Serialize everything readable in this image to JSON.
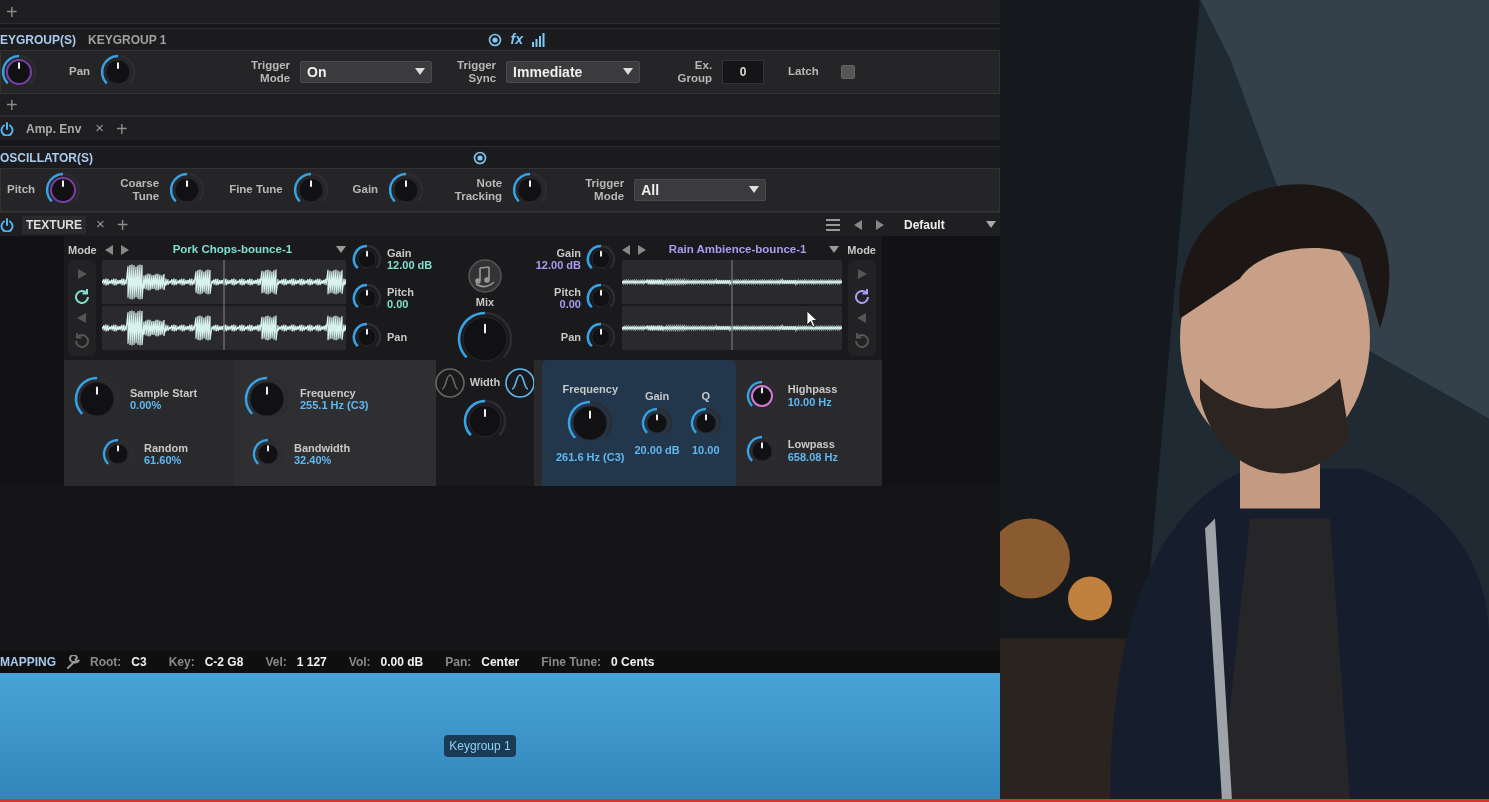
{
  "top_bar": {
    "add": "+"
  },
  "keygroup": {
    "title": "EYGROUP(S)",
    "name": "KEYGROUP 1",
    "fx": "fx",
    "knobs": [
      {
        "kind": "plain"
      },
      {
        "kind": "labeled",
        "label": "Pan"
      }
    ],
    "trigger_mode": {
      "label": "Trigger Mode",
      "value": "On"
    },
    "trigger_sync": {
      "label": "Trigger Sync",
      "value": "Immediate"
    },
    "ex_group": {
      "label": "Ex. Group",
      "value": "0"
    },
    "latch": {
      "label": "Latch",
      "checked": false
    }
  },
  "add_module": "+",
  "modules": {
    "items": [
      {
        "name": "Amp. Env",
        "close": "×",
        "on": true
      }
    ],
    "add": "+"
  },
  "oscillator": {
    "title": "OSCILLATOR(S)",
    "knobs": [
      {
        "label": "Pitch"
      },
      {
        "label": "Coarse Tune"
      },
      {
        "label": "Fine Tune"
      },
      {
        "label": "Gain"
      },
      {
        "label": "Note Tracking"
      }
    ],
    "trigger_mode": {
      "label": "Trigger Mode",
      "value": "All"
    }
  },
  "texture": {
    "tab": {
      "name": "TEXTURE",
      "close": "×",
      "on": true
    },
    "add": "+",
    "preset": "Default",
    "layers": [
      {
        "mode": "Mode",
        "sample": "Pork Chops-bounce-1",
        "color": "#7fe0cf",
        "transport": [
          {
            "kind": "play",
            "selected": false
          },
          {
            "kind": "loop",
            "selected": true
          },
          {
            "kind": "reverse",
            "selected": false
          },
          {
            "kind": "loop-back",
            "selected": false
          }
        ],
        "knobs": [
          {
            "label": "Gain",
            "value": "12.00 dB"
          },
          {
            "label": "Pitch",
            "value": "0.00"
          },
          {
            "label": "Pan"
          }
        ]
      },
      {
        "mode": "Mode",
        "sample": "Rain Ambience-bounce-1",
        "color": "#a99cf2",
        "transport": [
          {
            "kind": "play",
            "selected": false
          },
          {
            "kind": "loop",
            "selected": true
          },
          {
            "kind": "reverse",
            "selected": false
          },
          {
            "kind": "loop-back",
            "selected": false
          }
        ],
        "knobs": [
          {
            "label": "Gain",
            "value": "12.00 dB"
          },
          {
            "label": "Pitch",
            "value": "0.00"
          },
          {
            "label": "Pan"
          }
        ]
      }
    ],
    "mix": {
      "label": "Mix"
    },
    "width": {
      "label": "Width"
    },
    "filter_types": [
      {
        "selected": false
      },
      {
        "selected": true
      }
    ],
    "sample_start": {
      "label": "Sample Start",
      "value": "0.00%"
    },
    "random": {
      "label": "Random",
      "value": "61.60%"
    },
    "frequency": {
      "label": "Frequency",
      "value": "255.1 Hz (C3)"
    },
    "bandwidth": {
      "label": "Bandwidth",
      "value": "32.40%"
    },
    "eq": [
      {
        "label": "Frequency",
        "value": "261.6 Hz (C3)"
      },
      {
        "label": "Gain",
        "value": "20.00 dB"
      },
      {
        "label": "Q",
        "value": "10.00"
      }
    ],
    "highpass": {
      "label": "Highpass",
      "value": "10.00 Hz"
    },
    "lowpass": {
      "label": "Lowpass",
      "value": "658.08 Hz"
    }
  },
  "mapping": {
    "title": "MAPPING",
    "fields": [
      {
        "label": "Root:",
        "value": "C3"
      },
      {
        "label": "Key:",
        "value": "C-2 G8"
      },
      {
        "label": "Vel:",
        "value": "1 127"
      },
      {
        "label": "Vol:",
        "value": "0.00 dB"
      },
      {
        "label": "Pan:",
        "value": "Center"
      },
      {
        "label": "Fine Tune:",
        "value": "0 Cents"
      }
    ]
  },
  "keygroup_tag": "Keygroup 1"
}
